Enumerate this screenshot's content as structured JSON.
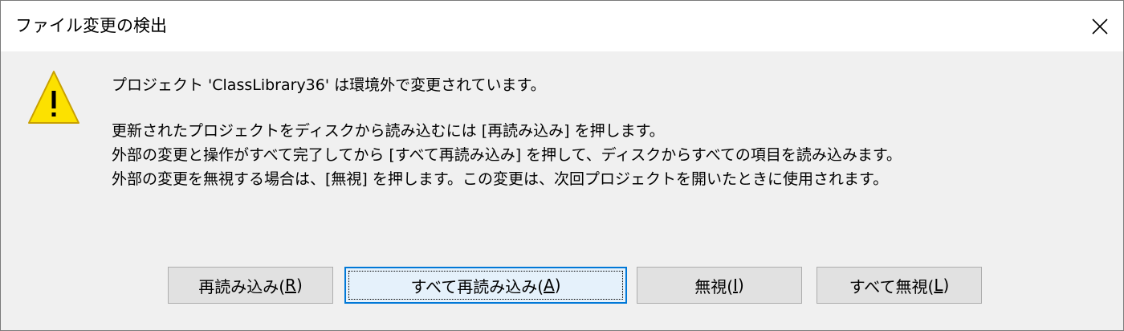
{
  "window": {
    "title": "ファイル変更の検出",
    "close_icon": "close-icon"
  },
  "message": {
    "icon": "warning-icon",
    "headline": "プロジェクト 'ClassLibrary36' は環境外で変更されています。",
    "lines": [
      "更新されたプロジェクトをディスクから読み込むには [再読み込み] を押します。",
      "外部の変更と操作がすべて完了してから [すべて再読み込み] を押して、ディスクからすべての項目を読み込みます。",
      "外部の変更を無視する場合は、[無視] を押します。この変更は、次回プロジェクトを開いたときに使用されます。"
    ]
  },
  "buttons": {
    "reload": {
      "label": "再読み込み(",
      "key": "R",
      "suffix": ")"
    },
    "reload_all": {
      "label": "すべて再読み込み(",
      "key": "A",
      "suffix": ")"
    },
    "ignore": {
      "label": "無視(",
      "key": "I",
      "suffix": ")"
    },
    "ignore_all": {
      "label": "すべて無視(",
      "key": "L",
      "suffix": ")"
    }
  },
  "colors": {
    "warning_fill": "#FCE100",
    "warning_stroke": "#C8A000",
    "default_button_border": "#0078D7",
    "default_button_bg": "#E5F1FB",
    "button_bg": "#E1E1E1"
  }
}
